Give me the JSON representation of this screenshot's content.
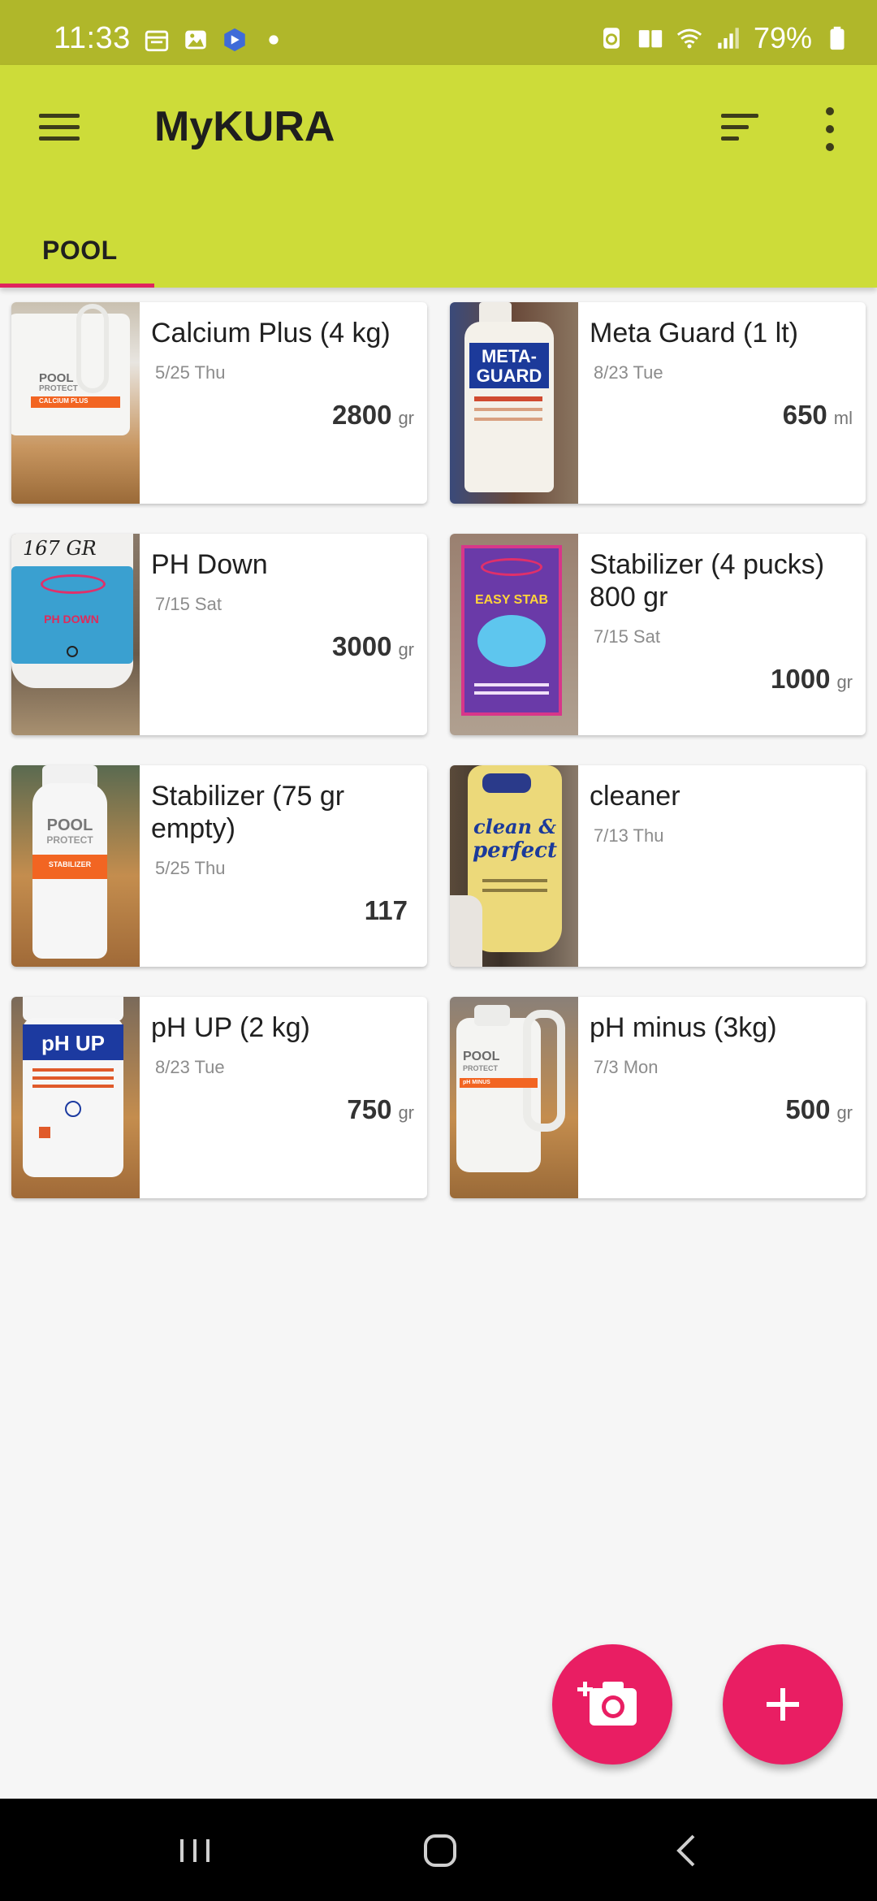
{
  "status_bar": {
    "time": "11:33",
    "battery": "79%",
    "left_icons": [
      "calendar-icon",
      "gallery-icon",
      "app-notification-icon",
      "dot-icon"
    ],
    "right_icons": [
      "recycle-icon",
      "book-icon",
      "wifi-icon",
      "signal-icon",
      "battery-icon"
    ]
  },
  "app_bar": {
    "title": "MyKURA",
    "menu_icon": "hamburger-menu-icon",
    "sort_icon": "sort-icon",
    "overflow_icon": "more-vert-icon",
    "background": "#cddc39"
  },
  "tabs": [
    {
      "label": "POOL",
      "selected": true
    }
  ],
  "items": [
    {
      "name": "Calcium Plus (4 kg)",
      "date": "5/25 Thu",
      "amount": "2800",
      "unit": "gr"
    },
    {
      "name": "Meta Guard (1 lt)",
      "date": "8/23 Tue",
      "amount": "650",
      "unit": "ml"
    },
    {
      "name": "PH Down",
      "date": "7/15 Sat",
      "amount": "3000",
      "unit": "gr"
    },
    {
      "name": "Stabilizer (4 pucks) 800 gr",
      "date": "7/15 Sat",
      "amount": "1000",
      "unit": "gr"
    },
    {
      "name": "Stabilizer (75 gr empty)",
      "date": "5/25 Thu",
      "amount": "117",
      "unit": ""
    },
    {
      "name": "cleaner",
      "date": "7/13 Thu",
      "amount": "",
      "unit": ""
    },
    {
      "name": "pH UP (2 kg)",
      "date": "8/23 Tue",
      "amount": "750",
      "unit": "gr"
    },
    {
      "name": "pH minus (3kg)",
      "date": "7/3 Mon",
      "amount": "500",
      "unit": "gr"
    }
  ],
  "product_labels": {
    "calcium": [
      "POOL",
      "PROTECT",
      "CALCIUM PLUS"
    ],
    "metaguard": [
      "META-",
      "GUARD"
    ],
    "phdown": [
      "167 GR",
      "PH DOWN"
    ],
    "easystab": [
      "EASY STAB"
    ],
    "stab75": [
      "POOL",
      "PROTECT",
      "STABILIZER"
    ],
    "cleaner": [
      "clean &",
      "perfect"
    ],
    "phup": [
      "pH UP"
    ],
    "phminus": [
      "POOL",
      "PROTECT",
      "pH MINUS"
    ]
  },
  "fabs": {
    "camera_icon": "add-photo-icon",
    "add_icon": "plus-icon",
    "color": "#e91e63"
  },
  "nav_bar": {
    "buttons": [
      "recent-apps-icon",
      "home-icon",
      "back-icon"
    ]
  }
}
